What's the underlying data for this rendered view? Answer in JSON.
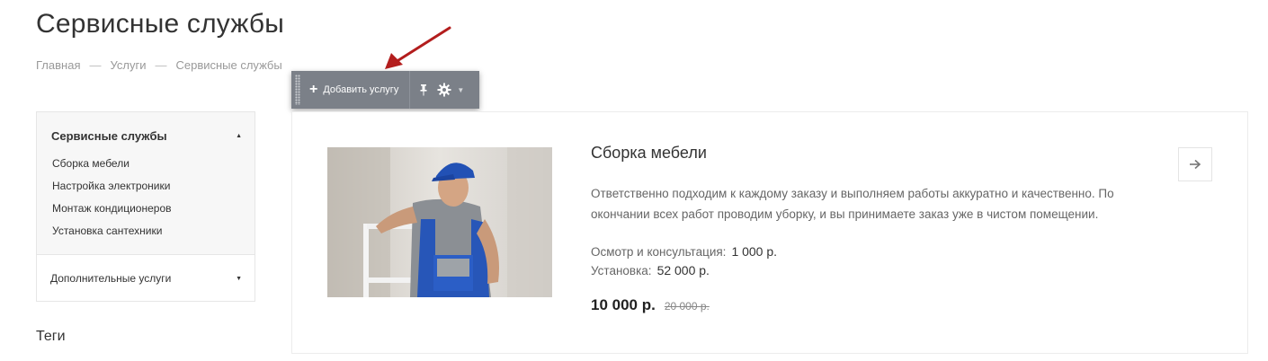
{
  "page": {
    "title": "Сервисные службы"
  },
  "breadcrumb": {
    "items": [
      "Главная",
      "Услуги",
      "Сервисные службы"
    ],
    "separator": "—"
  },
  "toolbar": {
    "add_label": "Добавить услугу",
    "icons": [
      "plus-icon",
      "pin-icon",
      "gear-icon",
      "caret-down-icon"
    ],
    "background": "#7b8088"
  },
  "sidebar": {
    "section_title": "Сервисные службы",
    "items": [
      {
        "label": "Сборка мебели"
      },
      {
        "label": "Настройка электроники"
      },
      {
        "label": "Монтаж кондиционеров"
      },
      {
        "label": "Установка сантехники"
      }
    ],
    "extra_title": "Дополнительные услуги"
  },
  "tags": {
    "title": "Теги"
  },
  "service": {
    "title": "Сборка мебели",
    "description": "Ответственно подходим к каждому заказу и выполняем работы аккуратно и качественно. По окончании всех работ проводим уборку, и вы принимаете заказ уже в чистом помещении.",
    "prices": [
      {
        "label": "Осмотр и консультация:",
        "value": "1 000 р."
      },
      {
        "label": "Установка:",
        "value": "52 000 р."
      }
    ],
    "price": "10 000 р.",
    "old_price": "20 000 р."
  },
  "colors": {
    "annotation_arrow": "#b31d1d",
    "text": "#333333",
    "muted": "#999999"
  }
}
